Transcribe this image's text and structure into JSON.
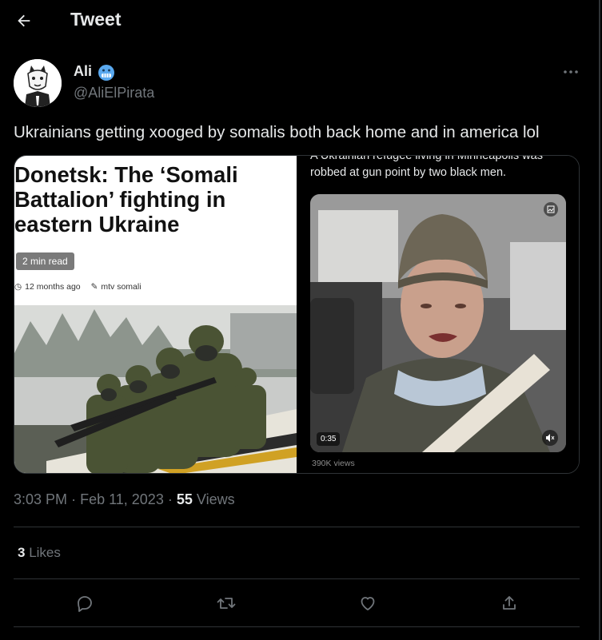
{
  "header": {
    "title": "Tweet",
    "back_icon": "arrow-left-icon"
  },
  "author": {
    "display_name": "Ali",
    "emoji_icon": "grimacing-cold-face-emoji-icon",
    "handle": "@AliElPirata"
  },
  "tweet": {
    "text": "Ukrainians getting xooged by somalis both back home and in america lol"
  },
  "media": {
    "left_article": {
      "headline": "Donetsk: The ‘Somali Battalion’ fighting in eastern Ukraine",
      "read_time": "2 min read",
      "age": "12 months ago",
      "source": "mtv somali"
    },
    "right_video": {
      "cut_caption": "A Ukrainian refugee living in Minneapolis was",
      "caption": "robbed at gun point by two black men.",
      "duration": "0:35",
      "views": "390K views"
    }
  },
  "meta": {
    "time": "3:03 PM",
    "separator": "·",
    "date": "Feb 11, 2023",
    "views_count": "55",
    "views_label": "Views"
  },
  "engagement": {
    "likes_count": "3",
    "likes_label": "Likes"
  },
  "actions": [
    "reply-icon",
    "retweet-icon",
    "like-icon",
    "share-icon"
  ],
  "colors": {
    "background": "#000000",
    "text": "#e7e9ea",
    "muted": "#71767b",
    "border": "#2f3336"
  }
}
